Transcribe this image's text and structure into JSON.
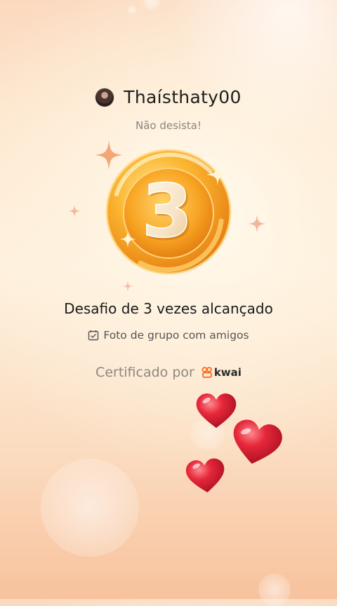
{
  "profile": {
    "username": "Thaísthaty00",
    "subtitle": "Não desista!"
  },
  "badge": {
    "number": "3"
  },
  "achievement": {
    "headline": "Desafio de 3 vezes alcançado",
    "task": "Foto de grupo com amigos"
  },
  "certification": {
    "label": "Certificado por",
    "brand": "kwai"
  },
  "colors": {
    "accent": "#f7a52e",
    "heart": "#e3293a"
  }
}
